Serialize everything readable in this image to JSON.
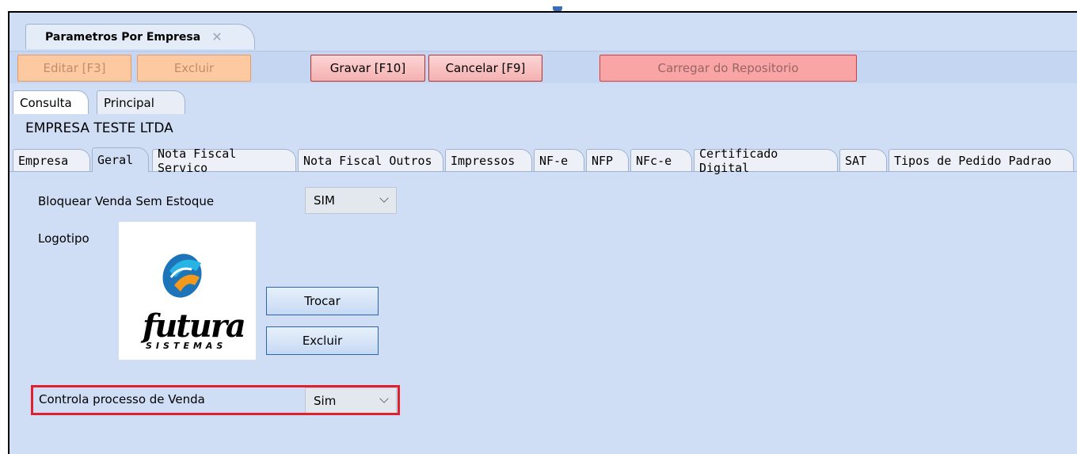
{
  "window": {
    "doc_tab_title": "Parametros Por Empresa",
    "doc_tab_close": "✕"
  },
  "toolbar": {
    "edit_label": "Editar [F3]",
    "delete_label": "Excluir",
    "save_label": "Gravar [F10]",
    "cancel_label": "Cancelar [F9]",
    "load_repo_label": "Carregar do Repositorio"
  },
  "view_tabs": [
    "Consulta",
    "Principal"
  ],
  "company_name": "EMPRESA TESTE LTDA",
  "section_tabs": [
    "Empresa",
    "Geral",
    "Nota Fiscal Servico",
    "Nota Fiscal Outros",
    "Impressos",
    "NF-e",
    "NFP",
    "NFc-e",
    "Certificado Digital",
    "SAT",
    "Tipos de Pedido Padrao"
  ],
  "active_section_tab": "Geral",
  "form": {
    "block_sale_label": "Bloquear Venda Sem Estoque",
    "block_sale_value": "SIM",
    "logo_label": "Logotipo",
    "logo_text": "futura",
    "logo_subtext": "SISTEMAS",
    "change_button": "Trocar",
    "remove_button": "Excluir",
    "sale_process_label": "Controla processo de Venda",
    "sale_process_value": "Sim"
  },
  "colors": {
    "background": "#cfdef5",
    "highlight": "#e0202f",
    "logo_blue": "#1d74b8",
    "logo_cyan": "#28b5e6",
    "logo_orange": "#f39a1e"
  }
}
